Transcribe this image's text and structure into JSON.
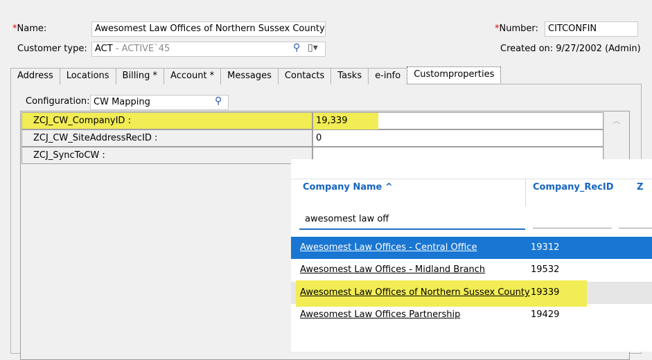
{
  "header": {
    "name_label": "Name:",
    "name_value": "Awesomest Law Offices of Northern Sussex County",
    "customer_type_label": "Customer type:",
    "customer_type_code": "ACT",
    "customer_type_desc": " - ACTIVE`45",
    "number_label": "Number:",
    "number_value": "CITCONFIN",
    "created_on": "Created on: 9/27/2002 (Admin)",
    "required_mark": "*"
  },
  "tabs": [
    {
      "label": "Address"
    },
    {
      "label": "Locations"
    },
    {
      "label": "Billing  *"
    },
    {
      "label": "Account *"
    },
    {
      "label": "Messages"
    },
    {
      "label": "Contacts"
    },
    {
      "label": "Tasks"
    },
    {
      "label": "e-info"
    },
    {
      "label": "Customproperties",
      "active": true
    }
  ],
  "config": {
    "label": "Configuration:",
    "value": "CW Mapping"
  },
  "properties": [
    {
      "name": "ZCJ_CW_CompanyID :",
      "value": "19,339",
      "highlighted": true
    },
    {
      "name": "ZCJ_CW_SiteAddressRecID :",
      "value": "0"
    },
    {
      "name": "ZCJ_SyncToCW :",
      "value": ""
    }
  ],
  "lookup": {
    "col_company_name": "Company Name ^",
    "col_recid": "Company_RecID",
    "col_third": "Z",
    "search_value": "awesomest law off",
    "results": [
      {
        "name": "Awesomest Law Offices - Central Office",
        "recid": "19312",
        "selected": true
      },
      {
        "name": "Awesomest Law Offices - Midland Branch",
        "recid": "19532"
      },
      {
        "name": "Awesomest Law Offices of Northern Sussex County",
        "recid": "19339",
        "highlighted": true
      },
      {
        "name": "Awesomest Law Offices Partnership",
        "recid": "19429"
      }
    ]
  },
  "colors": {
    "highlight": "#f2ec55",
    "selection": "#1976d2",
    "link_header": "#1565c0",
    "required": "#e00000"
  }
}
